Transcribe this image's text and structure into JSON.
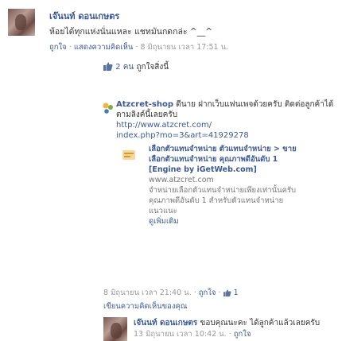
{
  "post": {
    "author": "เจ๊นนท์ ดอนเกษตร",
    "message": "ห้อยได้ทุกแห่งนั่นแหละ แชทมันกดกล่ะ ^__^",
    "meta": {
      "comment_link": "ถูกใจ",
      "separator": "·",
      "view_link": "แสดงความคิดเห็น",
      "timestamp": "8 มิถุนายน เวลา 17:51 น."
    },
    "likes": {
      "count_text": "2 คน",
      "label": "ถูกใจสิ่งนี้"
    }
  },
  "share": {
    "title": "Atzcret-shop",
    "text": "ดีนาย ฝากเว็บแฟนเพจด้วยครับ ติดต่อลูกค้าได้ตามลิงค์นี้เลยครับ",
    "url_line1": "http://www.atzcret.com/",
    "url_line2": "index.php?mo=3&art=41929278"
  },
  "attachment": {
    "title_line1": "เลือกตัวแทนจำหน่าย ตัวแทนจำหน่าย > ขาย",
    "title_line2": "เลือกตัวแทนจำหน่าย คุณภาพดีอันดับ 1",
    "title_line3": "[Engine by iGetWeb.com]",
    "domain": "www.atzcret.com",
    "desc_line1": "จำหน่ายเลือกตัวแทนจำหน่ายเพียงเท่านั้นครับ",
    "desc_line2": "คุณภาพดีอันดับ 1 สำหรับตัวแทนจำหน่าย",
    "desc_line3": "แนวแนะ",
    "more": "ดูเพิ่มเติม"
  },
  "comment_meta": {
    "timestamp": "8 มิถุนายน เวลา 21:40 น.",
    "separator": "·",
    "like_link": "ถูกใจ",
    "like_count": "1"
  },
  "reply_link": "เขียนความคิดเห็นของคุณ",
  "comment": {
    "author": "เจ๊นนท์ ดอนเกษตร",
    "text": "ขอบคุณนะคะ ได้ลูกค้าแล้วเลยครับ",
    "timestamp": "13 มิถุนายน เวลา 10:42 น.",
    "separator": "·",
    "like_link": "ถูกใจ"
  },
  "colors": {
    "link": "#3b5998",
    "muted": "#999999",
    "text": "#333333"
  }
}
